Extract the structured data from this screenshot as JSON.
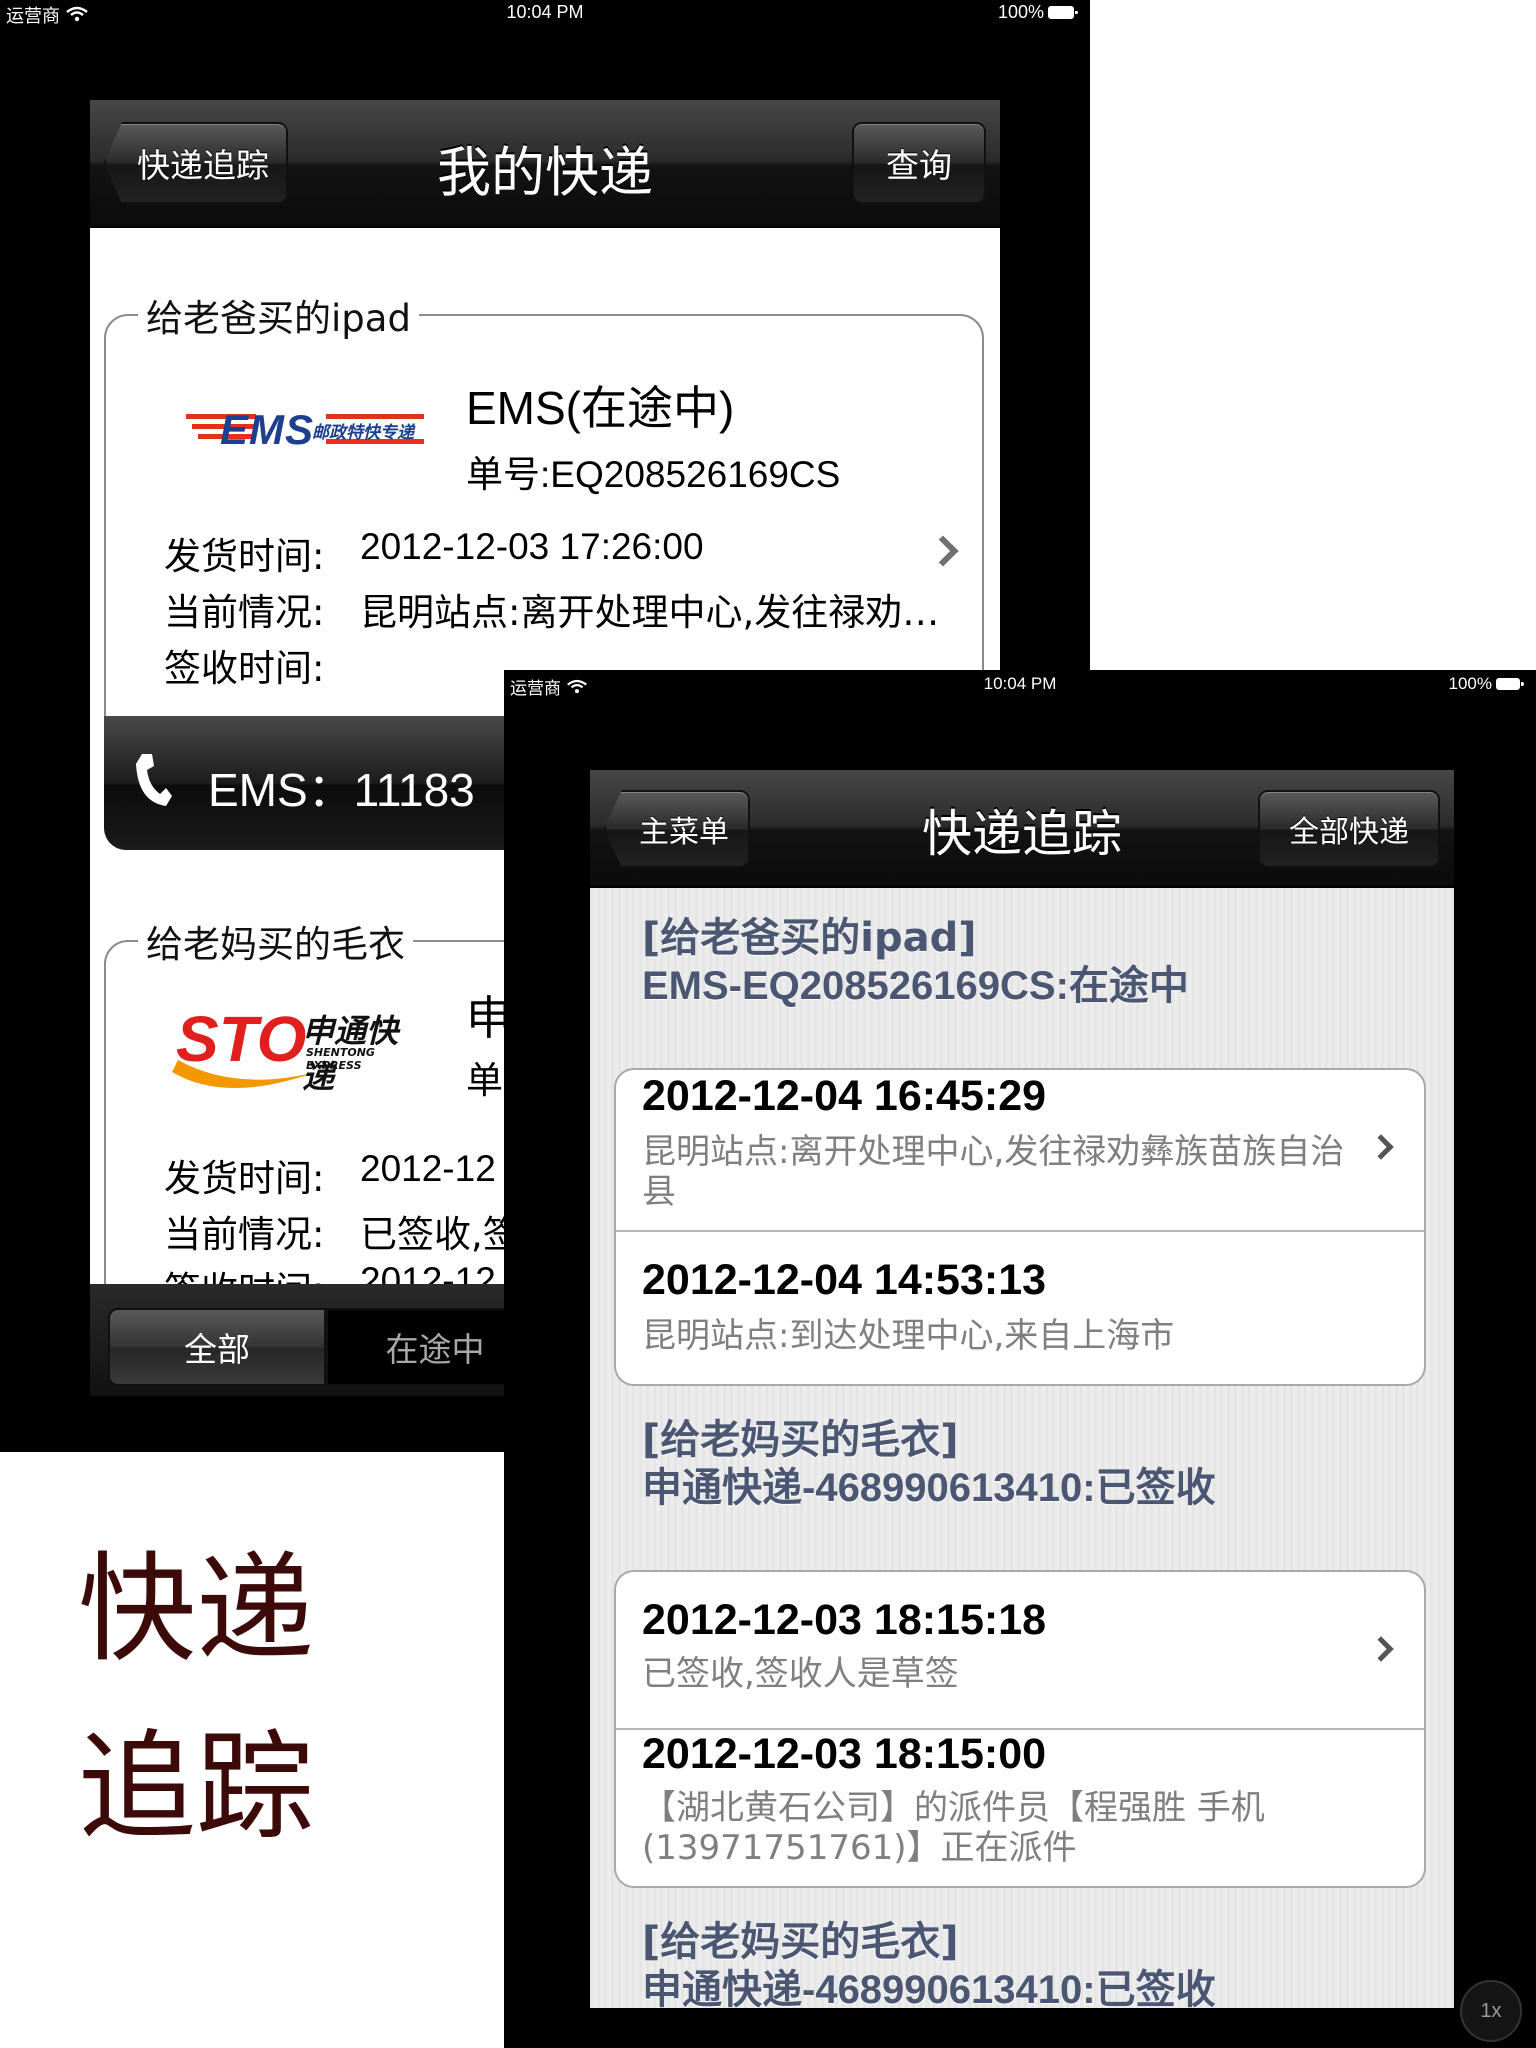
{
  "screen1": {
    "status": {
      "carrier": "运营商",
      "time": "10:04 PM",
      "battery": "100%"
    },
    "nav": {
      "back": "快递追踪",
      "title": "我的快递",
      "right": "查询"
    },
    "cards": [
      {
        "legend": "给老爸买的ipad",
        "logo_main": "EMS",
        "logo_sub": "邮政特快专递",
        "name": "EMS(在途中)",
        "number": "单号:EQ208526169CS",
        "ship_label": "发货时间:",
        "ship_value": "2012-12-03 17:26:00",
        "status_label": "当前情况:",
        "status_value": "昆明站点:离开处理中心,发往禄劝…",
        "sign_label": "签收时间:",
        "phone": "EMS：11183"
      },
      {
        "legend": "给老妈买的毛衣",
        "logo_main": "STO",
        "logo_sub": "申通快递",
        "logo_en": "SHENTONG EXPRESS",
        "name_partial": "申",
        "number_partial": "单",
        "ship_label": "发货时间:",
        "ship_value": "2012-12",
        "status_label": "当前情况:",
        "status_value": "已签收,签",
        "sign_label": "签收时间:",
        "sign_value": "2012-12"
      }
    ],
    "tabs": [
      "全部",
      "在途中"
    ]
  },
  "side": {
    "line1": "快递",
    "line2": "追踪"
  },
  "screen2": {
    "status": {
      "carrier": "运营商",
      "time": "10:04 PM",
      "battery": "100%"
    },
    "nav": {
      "back": "主菜单",
      "title": "快递追踪",
      "right": "全部快递"
    },
    "groups": [
      {
        "title1": "[给老爸买的ipad]",
        "title2": "EMS-EQ208526169CS:在途中",
        "items": [
          {
            "time": "2012-12-04 16:45:29",
            "desc": "昆明站点:离开处理中心,发往禄劝彝族苗族自治县"
          },
          {
            "time": "2012-12-04 14:53:13",
            "desc": "昆明站点:到达处理中心,来自上海市"
          }
        ]
      },
      {
        "title1": "[给老妈买的毛衣]",
        "title2": "申通快递-468990613410:已签收",
        "items": [
          {
            "time": "2012-12-03 18:15:18",
            "desc": "已签收,签收人是草签"
          },
          {
            "time": "2012-12-03 18:15:00",
            "desc": "【湖北黄石公司】的派件员【程强胜 手机(13971751761)】正在派件"
          }
        ]
      },
      {
        "title1": "[给老妈买的毛衣]",
        "title2": "申通快递-468990613410:已签收"
      }
    ]
  },
  "zoom": "1x",
  "colors": {
    "group_title": "#4a5672",
    "side_text": "#3d0a0a",
    "ems_red": "#e5301c",
    "ems_blue": "#1d3f8f",
    "sto_red": "#e01f1f",
    "sto_orange": "#f39800"
  }
}
